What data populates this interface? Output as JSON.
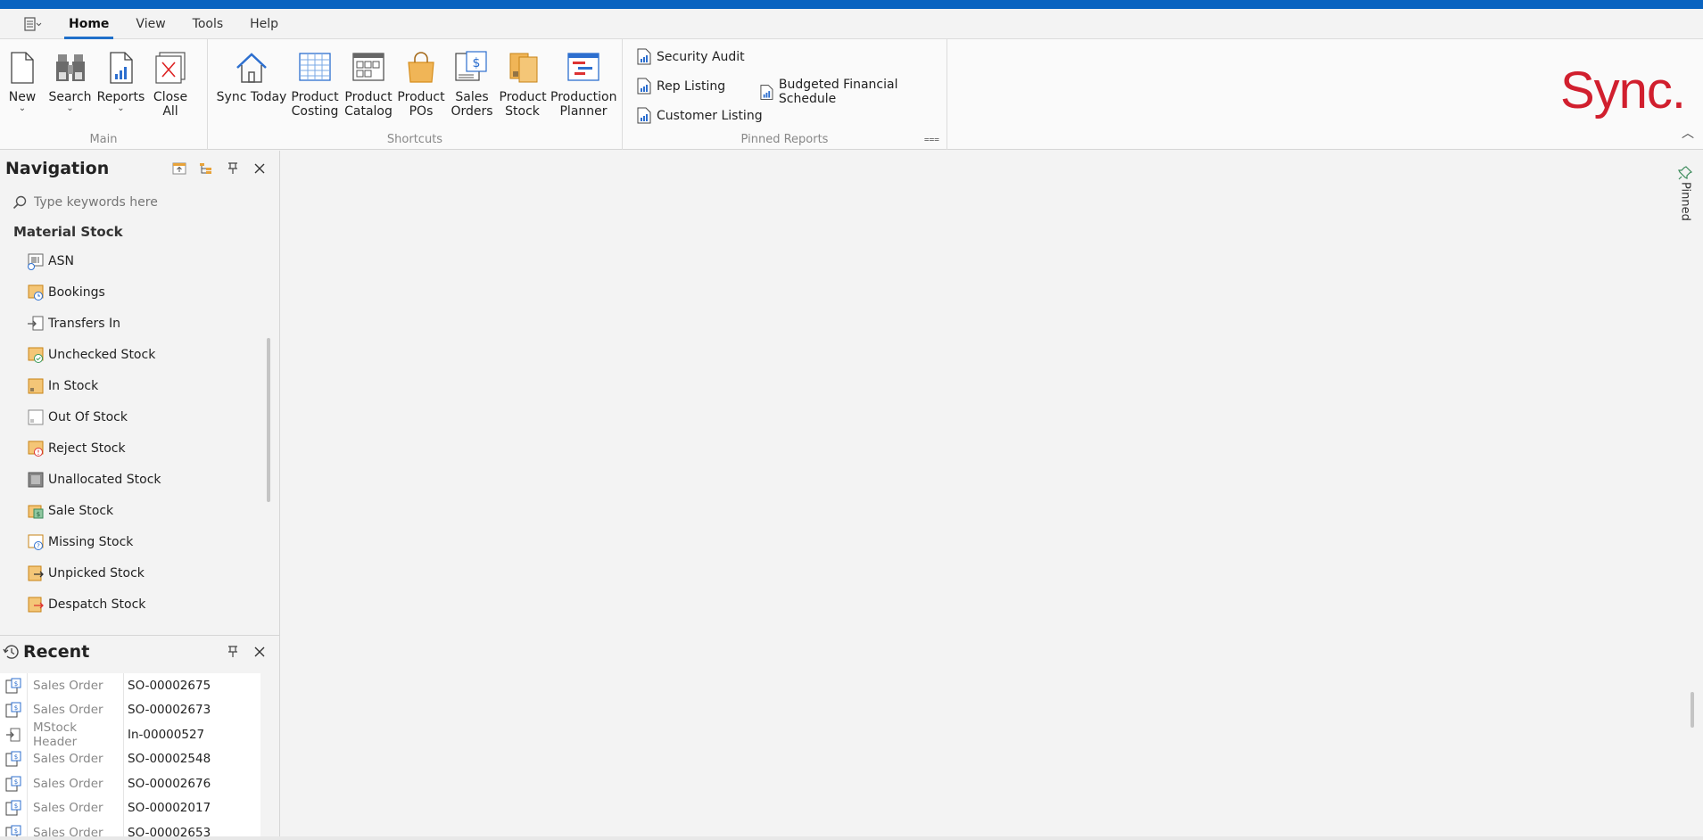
{
  "menu": {
    "tabs": [
      "Home",
      "View",
      "Tools",
      "Help"
    ]
  },
  "ribbon": {
    "main": {
      "caption": "Main",
      "buttons": [
        {
          "label": "New",
          "icon": "new-document-icon"
        },
        {
          "label": "Search",
          "icon": "binoculars-icon"
        },
        {
          "label": "Reports",
          "icon": "report-icon"
        },
        {
          "label": "Close All",
          "icon": "close-all-icon"
        }
      ]
    },
    "shortcuts": {
      "caption": "Shortcuts",
      "buttons": [
        {
          "label": "Sync Today"
        },
        {
          "label": "Product Costing"
        },
        {
          "label": "Product Catalog"
        },
        {
          "label": "Product POs"
        },
        {
          "label": "Sales Orders"
        },
        {
          "label": "Product Stock"
        },
        {
          "label": "Production Planner"
        }
      ]
    },
    "pinned_reports": {
      "caption": "Pinned Reports",
      "items": [
        "Security Audit",
        "Rep Listing",
        "Budgeted Financial Schedule",
        "Customer Listing"
      ]
    },
    "logo": "Sync."
  },
  "navigation": {
    "title": "Navigation",
    "search_placeholder": "Type keywords here",
    "section": "Material Stock",
    "items": [
      "ASN",
      "Bookings",
      "Transfers In",
      "Unchecked Stock",
      "In Stock",
      "Out Of Stock",
      "Reject Stock",
      "Unallocated Stock",
      "Sale Stock",
      "Missing Stock",
      "Unpicked Stock",
      "Despatch Stock"
    ]
  },
  "recent": {
    "title": "Recent",
    "rows": [
      {
        "type": "Sales Order",
        "id": "SO-00002675"
      },
      {
        "type": "Sales Order",
        "id": "SO-00002673"
      },
      {
        "type": "MStock Header",
        "id": "In-00000527"
      },
      {
        "type": "Sales Order",
        "id": "SO-00002548"
      },
      {
        "type": "Sales Order",
        "id": "SO-00002676"
      },
      {
        "type": "Sales Order",
        "id": "SO-00002017"
      },
      {
        "type": "Sales Order",
        "id": "SO-00002653"
      }
    ]
  },
  "side": {
    "pinned_label": "Pinned"
  },
  "colors": {
    "accent": "#0a64c0",
    "logo": "#d11f2e"
  }
}
